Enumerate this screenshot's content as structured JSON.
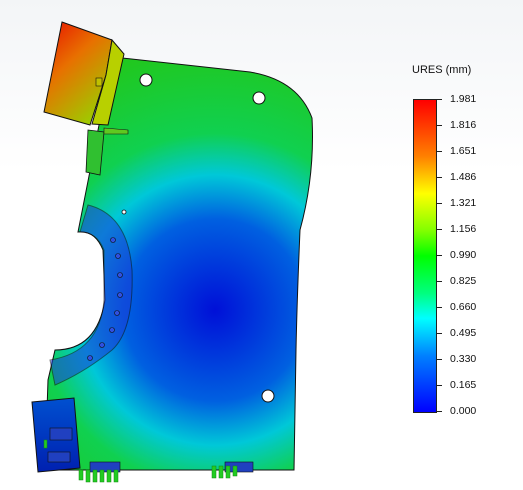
{
  "legend": {
    "title": "URES (mm)",
    "ticks": [
      "1.981",
      "1.816",
      "1.651",
      "1.486",
      "1.321",
      "1.156",
      "0.990",
      "0.825",
      "0.660",
      "0.495",
      "0.330",
      "0.165",
      "0.000"
    ],
    "min": 0.0,
    "max": 1.981
  },
  "colors": {
    "max": "#ff0000",
    "mid": "#00ff00",
    "min": "#0000ff",
    "fixture": "#22cc22"
  }
}
